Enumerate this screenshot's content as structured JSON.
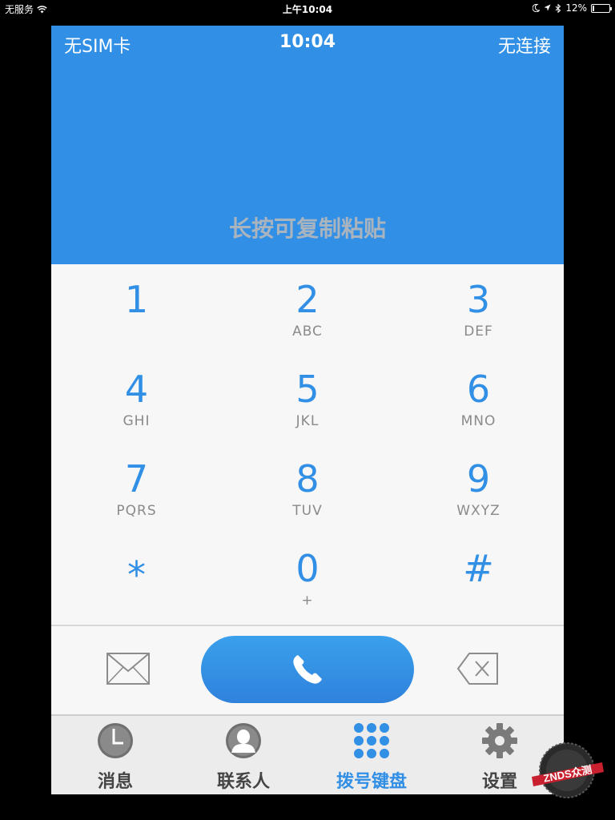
{
  "status_bar": {
    "carrier": "无服务",
    "time": "上午10:04",
    "battery": "12%",
    "battery_level": 0.12,
    "icons": [
      "wifi-icon",
      "moon-icon",
      "location-icon",
      "bluetooth-icon",
      "battery-icon"
    ]
  },
  "header": {
    "sim": "无SIM卡",
    "time": "10:04",
    "connection": "无连接",
    "hint": "长按可复制粘贴",
    "color": "#318fe5"
  },
  "keypad": [
    {
      "digit": "1",
      "letters": ""
    },
    {
      "digit": "2",
      "letters": "ABC"
    },
    {
      "digit": "3",
      "letters": "DEF"
    },
    {
      "digit": "4",
      "letters": "GHI"
    },
    {
      "digit": "5",
      "letters": "JKL"
    },
    {
      "digit": "6",
      "letters": "MNO"
    },
    {
      "digit": "7",
      "letters": "PQRS"
    },
    {
      "digit": "8",
      "letters": "TUV"
    },
    {
      "digit": "9",
      "letters": "WXYZ"
    },
    {
      "digit": "*",
      "letters": ""
    },
    {
      "digit": "0",
      "letters": "+"
    },
    {
      "digit": "#",
      "letters": ""
    }
  ],
  "actions": {
    "message_icon": "envelope-icon",
    "call_icon": "phone-icon",
    "backspace_icon": "backspace-icon"
  },
  "tabs": [
    {
      "label": "消息",
      "icon": "clock-icon",
      "active": false
    },
    {
      "label": "联系人",
      "icon": "contact-icon",
      "active": false
    },
    {
      "label": "拨号键盘",
      "icon": "keypad-icon",
      "active": true
    },
    {
      "label": "设置",
      "icon": "gear-icon",
      "active": false
    }
  ],
  "watermark": {
    "text": "ZNDS众测"
  }
}
